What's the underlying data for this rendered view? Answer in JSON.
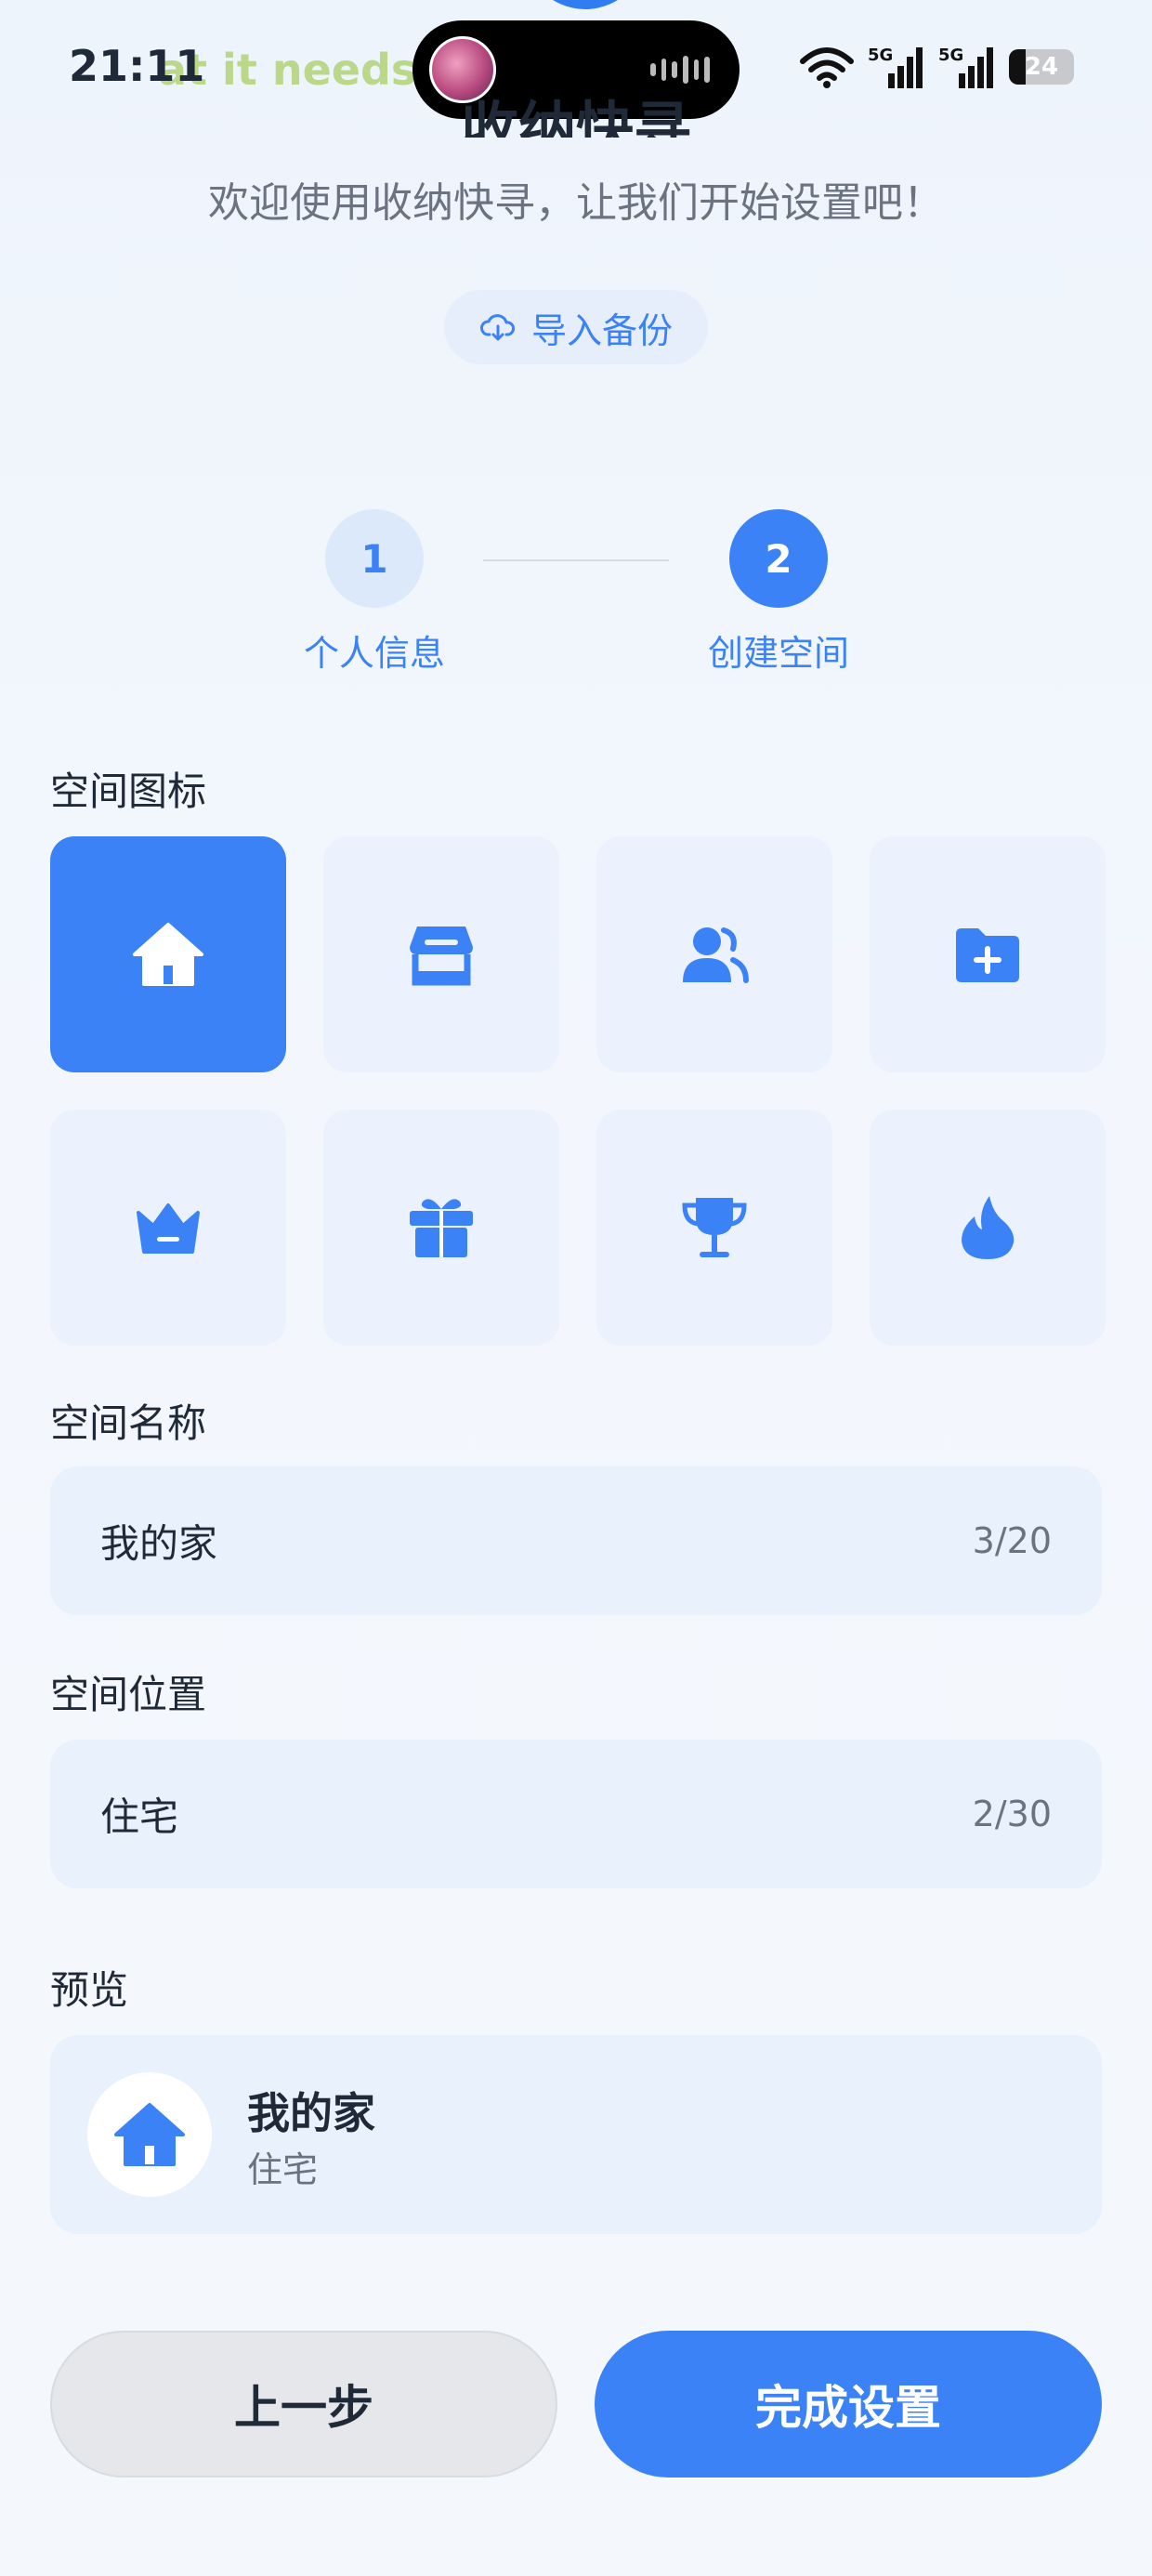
{
  "status_bar": {
    "time": "21:11",
    "marquee": "at it needs i",
    "battery": "24"
  },
  "header": {
    "title": "收纳快寻",
    "subtitle": "欢迎使用收纳快寻，让我们开始设置吧！",
    "import_label": "导入备份"
  },
  "steps": [
    {
      "number": "1",
      "label": "个人信息"
    },
    {
      "number": "2",
      "label": "创建空间"
    }
  ],
  "sections": {
    "icon_label": "空间图标",
    "name_label": "空间名称",
    "location_label": "空间位置",
    "preview_label": "预览"
  },
  "icons": [
    "home-icon",
    "store-icon",
    "users-icon",
    "folder-plus-icon",
    "crown-icon",
    "gift-icon",
    "trophy-icon",
    "flame-icon"
  ],
  "selected_icon": "home-icon",
  "name_field": {
    "value": "我的家",
    "count": "3/20"
  },
  "location_field": {
    "value": "住宅",
    "count": "2/30"
  },
  "preview": {
    "name": "我的家",
    "location": "住宅"
  },
  "buttons": {
    "prev": "上一步",
    "finish": "完成设置"
  },
  "colors": {
    "accent": "#3b82f6",
    "tile_bg": "#ebf2fd",
    "field_bg": "#e9f1fd"
  }
}
